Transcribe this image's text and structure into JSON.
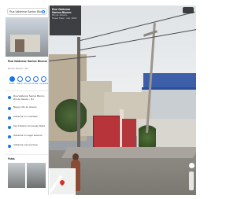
{
  "search": {
    "value": "Rua Valdemar Santos Blumm"
  },
  "place": {
    "name": "Rua Valdemar Santos Blumm",
    "subtitle": "Rio de Janeiro - RJ"
  },
  "actions": [
    {
      "label": "Rotas",
      "icon": "directions-icon"
    },
    {
      "label": "Salvar",
      "icon": "bookmark-icon"
    },
    {
      "label": "Por perto",
      "icon": "nearby-icon"
    },
    {
      "label": "Enviar",
      "icon": "send-to-phone-icon"
    },
    {
      "label": "Compartilhar",
      "icon": "share-icon"
    }
  ],
  "info": [
    {
      "icon": "pin-icon",
      "text": "Rua Valdemar Santos Blumm, Rio de Janeiro - RJ"
    },
    {
      "icon": "plus-code-icon",
      "text": "Bangu, Rio de Janeiro"
    },
    {
      "icon": "label-icon",
      "text": "Adicionar um marcador"
    },
    {
      "icon": "history-icon",
      "text": "Seu histórico do Google Maps"
    },
    {
      "icon": "add-place-icon",
      "text": "Adicionar um lugar ausente"
    },
    {
      "icon": "business-icon",
      "text": "Adicionar sua empresa"
    }
  ],
  "photos_label": "Fotos",
  "streetview_card": {
    "title": "Rua Valdemar Santos Blumm",
    "subtitle": "Rio de Janeiro",
    "date": "Street View - mar. 2019"
  },
  "colors": {
    "accent": "#1a73e8",
    "gate": "#b7343a",
    "warehouse_roof": "#2c4f97"
  }
}
